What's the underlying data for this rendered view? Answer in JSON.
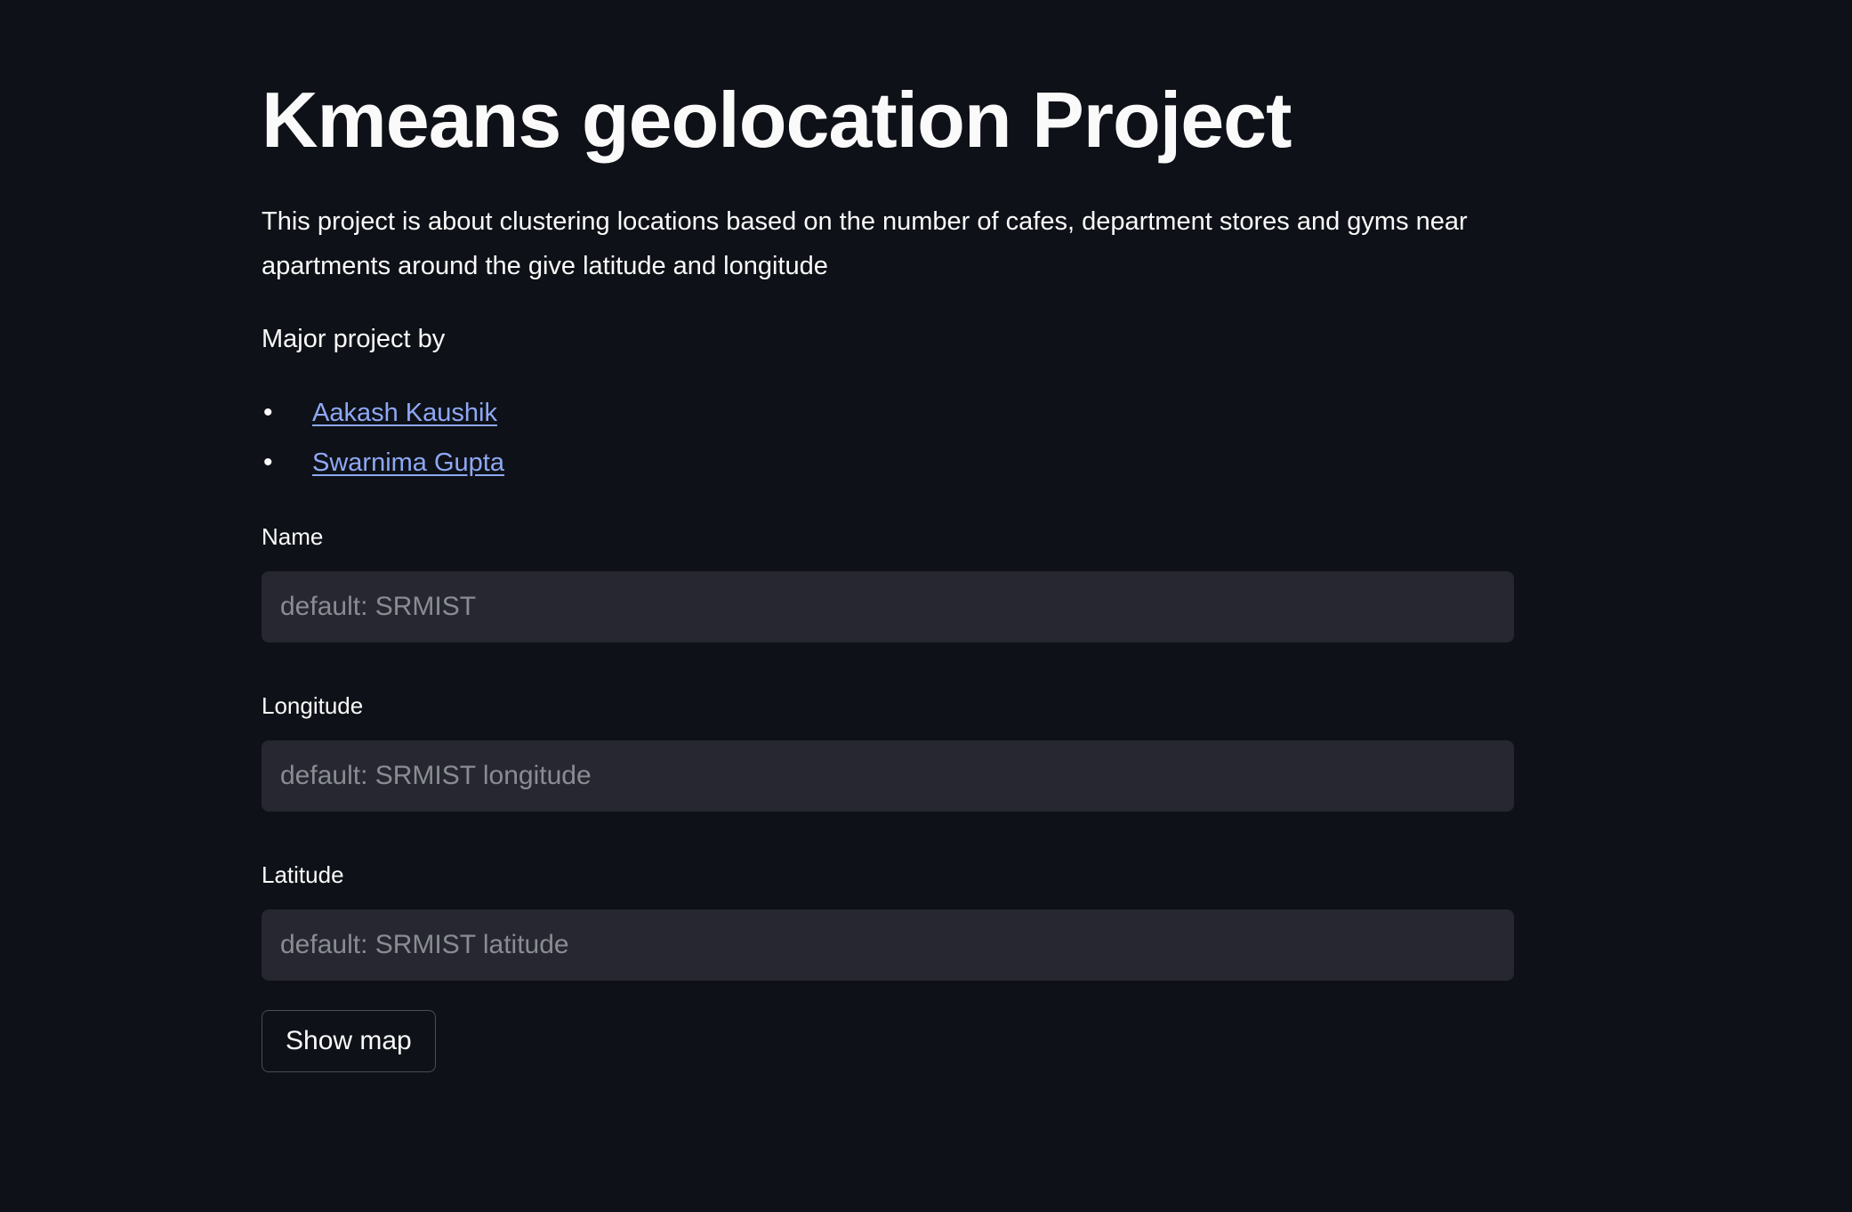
{
  "page": {
    "title": "Kmeans geolocation Project",
    "description": "This project is about clustering locations based on the number of cafes, department stores and gyms near apartments around the give latitude and longitude",
    "byline": "Major project by",
    "authors": [
      {
        "name": "Aakash Kaushik"
      },
      {
        "name": "Swarnima Gupta"
      }
    ]
  },
  "form": {
    "name": {
      "label": "Name",
      "value": "",
      "placeholder": "default: SRMIST"
    },
    "longitude": {
      "label": "Longitude",
      "value": "",
      "placeholder": "default: SRMIST longitude"
    },
    "latitude": {
      "label": "Latitude",
      "value": "",
      "placeholder": "default: SRMIST latitude"
    },
    "submit_label": "Show map"
  },
  "theme": {
    "background": "#0e1117",
    "text": "#fafafa",
    "input_background": "#262730",
    "link": "#8ea8f5",
    "placeholder": "#8a8c93"
  }
}
